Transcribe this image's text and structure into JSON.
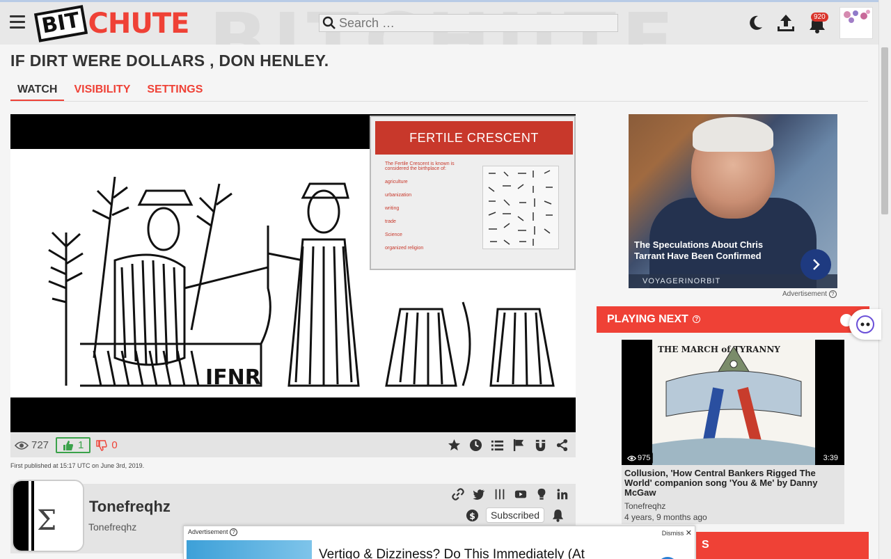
{
  "header": {
    "logo_bit": "BIT",
    "logo_chute": "CHUTE",
    "search_placeholder": "Search …",
    "notification_count": "920",
    "icons": [
      "menu-icon",
      "moon-icon",
      "upload-icon",
      "bell-icon",
      "avatar"
    ]
  },
  "video": {
    "title": "IF DIRT WERE DOLLARS , DON HENLEY.",
    "tabs": [
      {
        "label": "WATCH",
        "active": true
      },
      {
        "label": "VISIBILITY",
        "active": false
      },
      {
        "label": "SETTINGS",
        "active": false
      }
    ],
    "slide_title": "FERTILE CRESCENT",
    "slide_bullets": [
      "The Fertile Crescent is known is considered the birthplace of:",
      "agriculture",
      "urbanization",
      "writing",
      "trade",
      "Science",
      "organized religion"
    ],
    "views": "727",
    "likes": "1",
    "dislikes": "0",
    "published": "First published at 15:17 UTC on June 3rd, 2019.",
    "action_icons": [
      "star-icon",
      "clock-icon",
      "list-icon",
      "flag-icon",
      "magnet-icon",
      "share-icon"
    ]
  },
  "channel": {
    "name": "Tonefreqhz",
    "owner": "Tonefreqhz",
    "subscribed_label": "Subscribed",
    "social_icons": [
      "link-icon",
      "twitter-icon",
      "bars-icon",
      "youtube-icon",
      "bulb-icon",
      "linkedin-icon"
    ]
  },
  "ad_right": {
    "caption": "The Speculations About Chris Tarrant Have Been Confirmed",
    "source": "VOYAGERINORBIT",
    "label": "Advertisement"
  },
  "playing_next": {
    "heading": "PLAYING NEXT",
    "cartoon_title": "THE MARCH of TYRANNY",
    "views": "975",
    "duration": "3:39",
    "title": "Collusion, 'How Central Bankers Rigged The World' companion song 'You & Me' by Danny McGaw",
    "channel": "Tonefreqhz",
    "age": "4 years, 9 months ago"
  },
  "second_section": {
    "heading_fragment": "S"
  },
  "ad_bottom": {
    "label": "Advertisement",
    "dismiss": "Dismiss",
    "text": "Vertigo & Dizziness? Do This Immediately (At"
  },
  "colors": {
    "brand_red": "#ef4136",
    "like_green": "#3aa24a",
    "header_bg": "#e8e8e8"
  }
}
